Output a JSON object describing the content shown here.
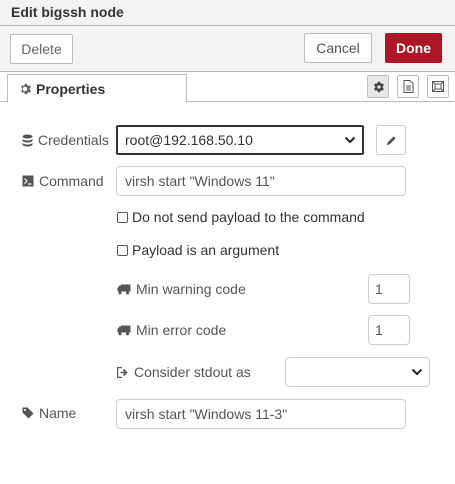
{
  "window": {
    "title": "Edit bigssh node"
  },
  "toolbar": {
    "delete_label": "Delete",
    "cancel_label": "Cancel",
    "done_label": "Done"
  },
  "tabs": {
    "properties_label": "Properties"
  },
  "form": {
    "credentials": {
      "label": "Credentials",
      "value": "root@192.168.50.10"
    },
    "command": {
      "label": "Command",
      "value": "virsh start \"Windows 11\""
    },
    "no_payload": {
      "label": "Do not send payload to the command",
      "checked": false
    },
    "payload_arg": {
      "label": "Payload is an argument",
      "checked": false
    },
    "min_warning": {
      "label": "Min warning code",
      "value": "1"
    },
    "min_error": {
      "label": "Min error code",
      "value": "1"
    },
    "stdout": {
      "label": "Consider stdout as",
      "value": ""
    },
    "name": {
      "label": "Name",
      "value": "virsh start \"Windows 11-3\""
    }
  },
  "colors": {
    "done_button": "#ad1625",
    "header_bg": "#f3f3f3"
  }
}
